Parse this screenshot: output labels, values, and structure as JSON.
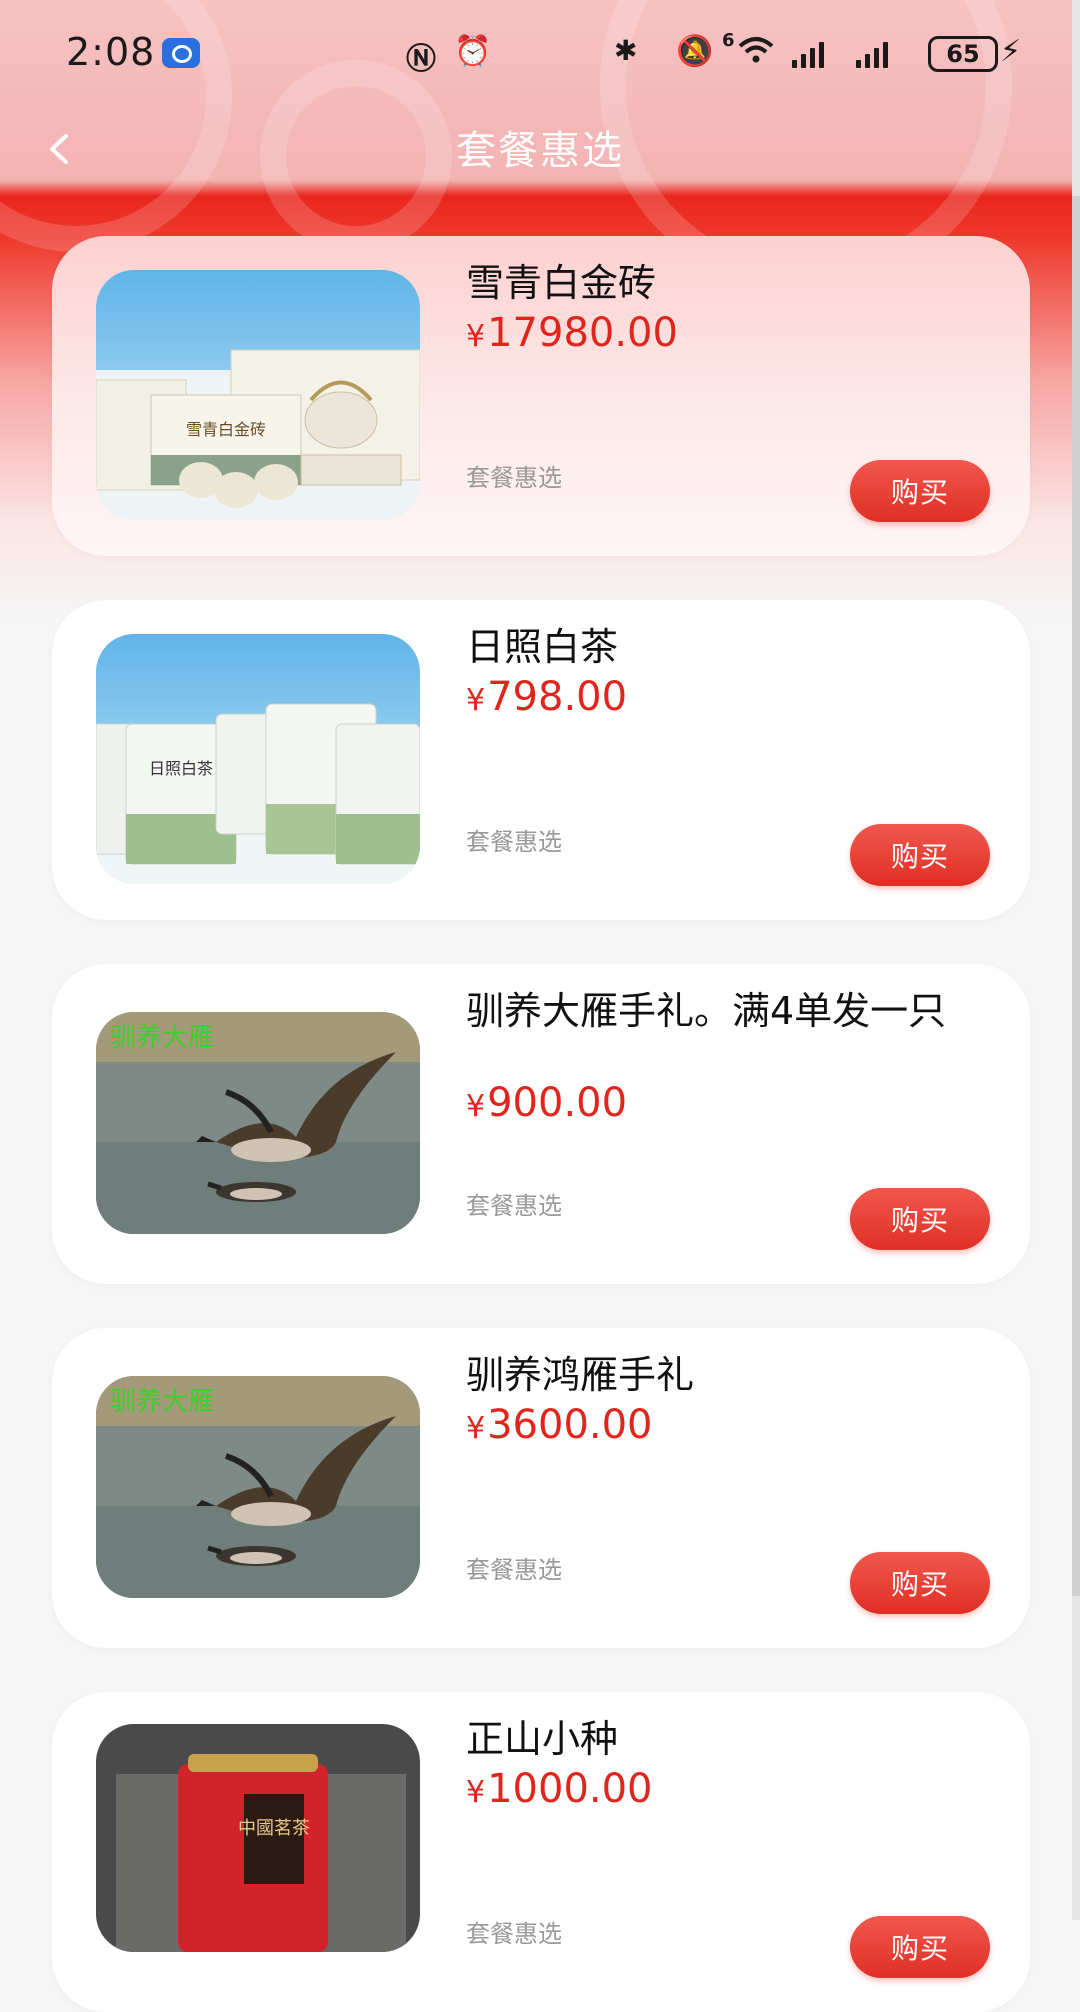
{
  "status_bar": {
    "time": "2:08",
    "battery": "65",
    "network_label": "6"
  },
  "nav": {
    "title": "套餐惠选",
    "back_icon": "chevron-left-icon"
  },
  "products": [
    {
      "name": "雪青白金砖",
      "currency": "¥",
      "price": "17980.00",
      "tag": "套餐惠选",
      "buy_label": "购买",
      "image_text": "雪青白金砖"
    },
    {
      "name": "日照白茶",
      "currency": "¥",
      "price": "798.00",
      "tag": "套餐惠选",
      "buy_label": "购买",
      "image_text": "日照白茶"
    },
    {
      "name": "驯养大雁手礼。满4单发一只",
      "currency": "¥",
      "price": "900.00",
      "tag": "套餐惠选",
      "buy_label": "购买",
      "image_text": "驯养大雁"
    },
    {
      "name": "驯养鸿雁手礼",
      "currency": "¥",
      "price": "3600.00",
      "tag": "套餐惠选",
      "buy_label": "购买",
      "image_text": "驯养大雁"
    },
    {
      "name": "正山小种",
      "currency": "¥",
      "price": "1000.00",
      "tag": "套餐惠选",
      "buy_label": "购买",
      "image_text": "中國茗茶"
    }
  ],
  "colors": {
    "accent": "#e0261c",
    "header_top": "#f7c2c2",
    "header_red": "#e8261c"
  }
}
